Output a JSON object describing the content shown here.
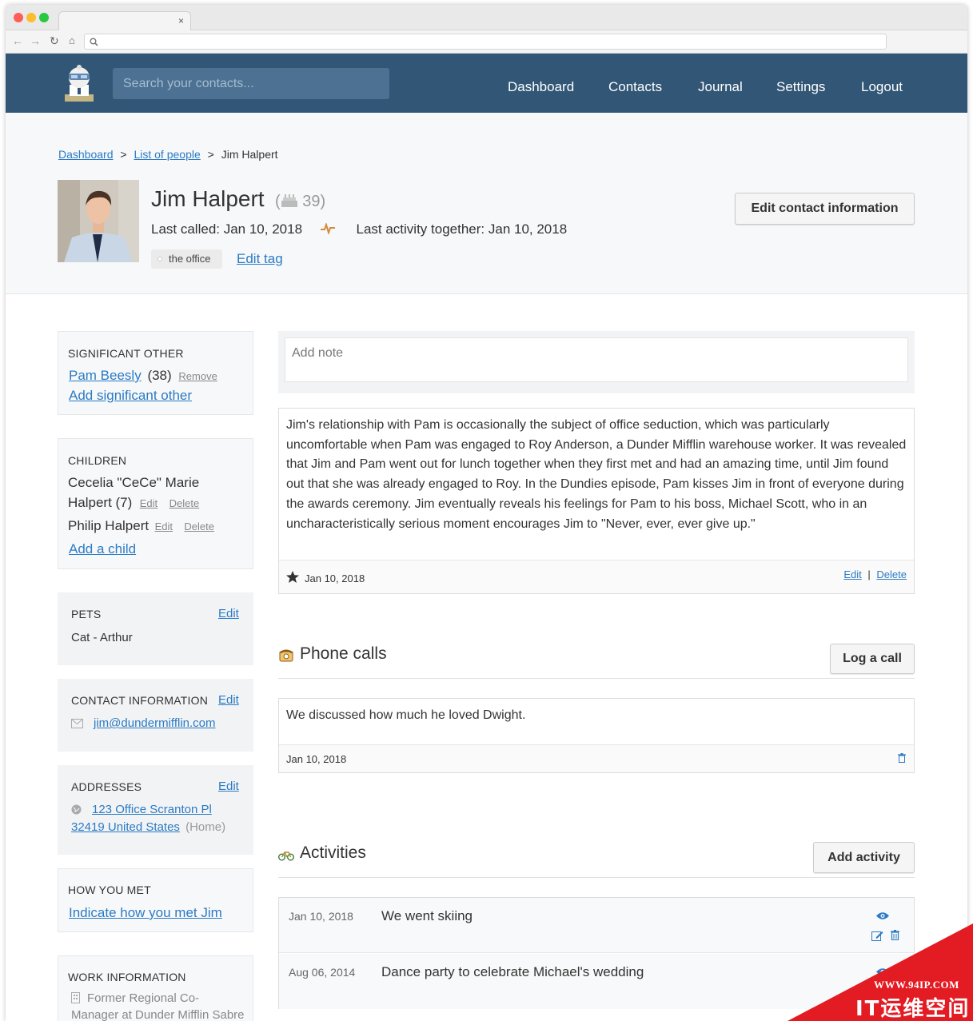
{
  "browser": {
    "tab_close": "×"
  },
  "header": {
    "search_placeholder": "Search your contacts...",
    "nav": [
      "Dashboard",
      "Contacts",
      "Journal",
      "Settings",
      "Logout"
    ]
  },
  "breadcrumb": {
    "home": "Dashboard",
    "list": "List of people",
    "sep": ">",
    "current": "Jim Halpert"
  },
  "profile": {
    "name": "Jim Halpert",
    "age": "39",
    "last_called": "Last called: Jan 10, 2018",
    "last_activity": "Last activity together: Jan 10, 2018",
    "tag": "the office",
    "edit_tag": "Edit tag",
    "edit_contact_button": "Edit contact information"
  },
  "sidebar": {
    "significant_other": {
      "title": "SIGNIFICANT OTHER",
      "name": "Pam Beesly",
      "age": "(38)",
      "remove": "Remove",
      "add": "Add significant other"
    },
    "children": {
      "title": "CHILDREN",
      "child1_line1": "Cecelia \"CeCe\" Marie",
      "child1_line2": "Halpert (7)",
      "child2": "Philip Halpert",
      "edit": "Edit",
      "delete": "Delete",
      "add": "Add a child"
    },
    "pets": {
      "title": "PETS",
      "edit": "Edit",
      "item": "Cat - Arthur"
    },
    "contact_info": {
      "title": "CONTACT INFORMATION",
      "edit": "Edit",
      "email": "jim@dundermifflin.com"
    },
    "addresses": {
      "title": "ADDRESSES",
      "edit": "Edit",
      "line1": "123 Office Scranton Pl",
      "line2": "32419 United States",
      "type": "(Home)"
    },
    "how_met": {
      "title": "HOW YOU MET",
      "link": "Indicate how you met Jim"
    },
    "work": {
      "title": "WORK INFORMATION",
      "line1": "Former Regional Co-",
      "line2": "Manager at Dunder Mifflin Sabre"
    }
  },
  "notes": {
    "placeholder": "Add note",
    "item": {
      "text": "Jim's relationship with Pam is occasionally the subject of office seduction, which was particularly uncomfortable when Pam was engaged to Roy Anderson, a Dunder Mifflin warehouse worker. It was revealed that Jim and Pam went out for lunch together when they first met and had an amazing time, until Jim found out that she was already engaged to Roy. In the Dundies episode, Pam kisses Jim in front of everyone during the awards ceremony. Jim eventually reveals his feelings for Pam to his boss, Michael Scott, who in an uncharacteristically serious moment encourages Jim to \"Never, ever, ever give up.\"",
      "date": "Jan 10, 2018",
      "edit": "Edit",
      "sep": "|",
      "delete": "Delete"
    }
  },
  "phone_calls": {
    "title": "Phone calls",
    "button": "Log a call",
    "item": {
      "text": "We discussed how much he loved Dwight.",
      "date": "Jan 10, 2018"
    }
  },
  "activities": {
    "title": "Activities",
    "button": "Add activity",
    "items": [
      {
        "date": "Jan 10, 2018",
        "title": "We went skiing"
      },
      {
        "date": "Aug 06, 2014",
        "title": "Dance party to celebrate Michael's wedding"
      }
    ]
  },
  "watermark": {
    "url": "WWW.94IP.COM",
    "text": "IT运维空间"
  },
  "colors": {
    "header": "#325776",
    "link": "#2b7bc4",
    "search": "#4c7193",
    "watermark": "#e31b23"
  }
}
